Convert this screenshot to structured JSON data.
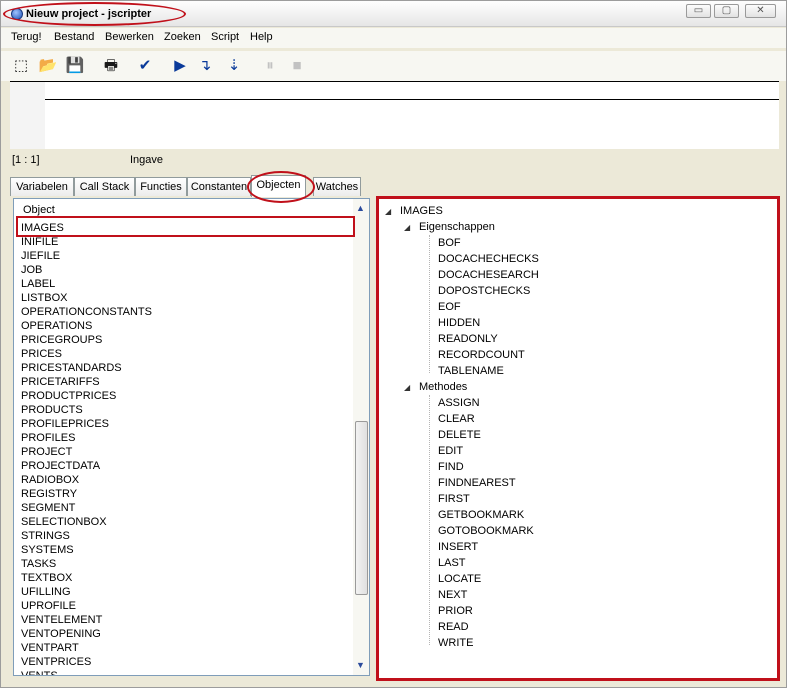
{
  "window": {
    "title": "Nieuw project - jscripter"
  },
  "window_controls": {
    "minimize": "▭",
    "maximize": "▢",
    "close": "✕"
  },
  "menu": [
    "Terug!",
    "Bestand",
    "Bewerken",
    "Zoeken",
    "Script",
    "Help"
  ],
  "toolbar": {
    "tools": [
      {
        "name": "new-file-icon",
        "glyph": "⬚"
      },
      {
        "name": "open-folder-icon",
        "glyph": "📂"
      },
      {
        "name": "save-icon",
        "glyph": "💾"
      },
      {
        "name": "print-icon",
        "glyph": "🖶"
      },
      {
        "name": "check-syntax-icon",
        "glyph": "✔"
      },
      {
        "name": "run-icon",
        "glyph": "▶"
      },
      {
        "name": "step-into-icon",
        "glyph": "↴"
      },
      {
        "name": "step-over-icon",
        "glyph": "⇣"
      },
      {
        "name": "pause-icon",
        "glyph": "⏸"
      },
      {
        "name": "stop-icon",
        "glyph": "■"
      }
    ]
  },
  "status": {
    "position": "[1 : 1]",
    "mode": "Ingave"
  },
  "tabs": [
    "Variabelen",
    "Call Stack",
    "Functies",
    "Constanten",
    "Objecten",
    "Watches"
  ],
  "active_tab": "Objecten",
  "object_list": {
    "header": "Object",
    "items": [
      "IMAGES",
      "INIFILE",
      "JIEFILE",
      "JOB",
      "LABEL",
      "LISTBOX",
      "OPERATIONCONSTANTS",
      "OPERATIONS",
      "PRICEGROUPS",
      "PRICES",
      "PRICESTANDARDS",
      "PRICETARIFFS",
      "PRODUCTPRICES",
      "PRODUCTS",
      "PROFILEPRICES",
      "PROFILES",
      "PROJECT",
      "PROJECTDATA",
      "RADIOBOX",
      "REGISTRY",
      "SEGMENT",
      "SELECTIONBOX",
      "STRINGS",
      "SYSTEMS",
      "TASKS",
      "TEXTBOX",
      "UFILLING",
      "UPROFILE",
      "VENTELEMENT",
      "VENTOPENING",
      "VENTPART",
      "VENTPRICES",
      "VENTS"
    ],
    "selected": "IMAGES"
  },
  "tree": {
    "root": "IMAGES",
    "groups": [
      {
        "label": "Eigenschappen",
        "items": [
          "BOF",
          "DOCACHECHECKS",
          "DOCACHESEARCH",
          "DOPOSTCHECKS",
          "EOF",
          "HIDDEN",
          "READONLY",
          "RECORDCOUNT",
          "TABLENAME"
        ]
      },
      {
        "label": "Methodes",
        "items": [
          "ASSIGN",
          "CLEAR",
          "DELETE",
          "EDIT",
          "FIND",
          "FINDNEAREST",
          "FIRST",
          "GETBOOKMARK",
          "GOTOBOOKMARK",
          "INSERT",
          "LAST",
          "LOCATE",
          "NEXT",
          "PRIOR",
          "READ",
          "WRITE"
        ]
      }
    ]
  },
  "colors": {
    "highlight": "#c0101a",
    "window_bg": "#ece9d8"
  }
}
